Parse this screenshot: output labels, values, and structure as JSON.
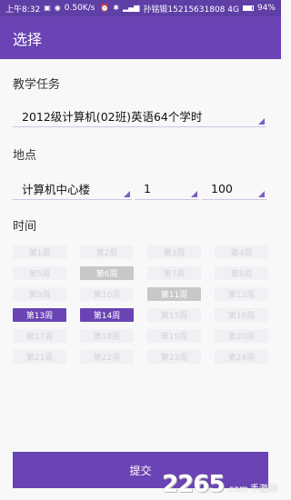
{
  "status_bar": {
    "time": "上午8:32",
    "speed": "0.50K/s",
    "carrier": "孙铭锻15215631808 4G",
    "battery": "94%"
  },
  "app_bar": {
    "title": "选择"
  },
  "sections": {
    "task_label": "教学任务",
    "task_value": "2012级计算机(02班)英语64个学时",
    "location_label": "地点",
    "building": "计算机中心楼",
    "floor": "1",
    "room": "100",
    "time_label": "时间"
  },
  "weeks": [
    [
      {
        "label": "第1周",
        "state": "normal"
      },
      {
        "label": "第2周",
        "state": "normal"
      },
      {
        "label": "第3周",
        "state": "normal"
      },
      {
        "label": "第4周",
        "state": "normal"
      }
    ],
    [
      {
        "label": "第5周",
        "state": "normal"
      },
      {
        "label": "第6周",
        "state": "gray"
      },
      {
        "label": "第7周",
        "state": "normal"
      },
      {
        "label": "第8周",
        "state": "normal"
      }
    ],
    [
      {
        "label": "第9周",
        "state": "normal"
      },
      {
        "label": "第10周",
        "state": "normal"
      },
      {
        "label": "第11周",
        "state": "gray"
      },
      {
        "label": "第12周",
        "state": "normal"
      }
    ],
    [
      {
        "label": "第13周",
        "state": "selected"
      },
      {
        "label": "第14周",
        "state": "selected"
      },
      {
        "label": "第15周",
        "state": "normal"
      },
      {
        "label": "第16周",
        "state": "normal"
      }
    ],
    [
      {
        "label": "第17周",
        "state": "normal"
      },
      {
        "label": "第18周",
        "state": "normal"
      },
      {
        "label": "第19周",
        "state": "normal"
      },
      {
        "label": "第20周",
        "state": "normal"
      }
    ],
    [
      {
        "label": "第21周",
        "state": "normal"
      },
      {
        "label": "第22周",
        "state": "normal"
      },
      {
        "label": "第23周",
        "state": "normal"
      },
      {
        "label": "第24周",
        "state": "normal"
      }
    ]
  ],
  "submit_label": "提交",
  "watermark": {
    "number": "2265",
    "suffix": ".com",
    "text": "手游网"
  },
  "colors": {
    "primary": "#6a43b4",
    "status_bar": "#5f3ea6",
    "selected": "#6a43b4",
    "gray": "#c8c8c8"
  }
}
